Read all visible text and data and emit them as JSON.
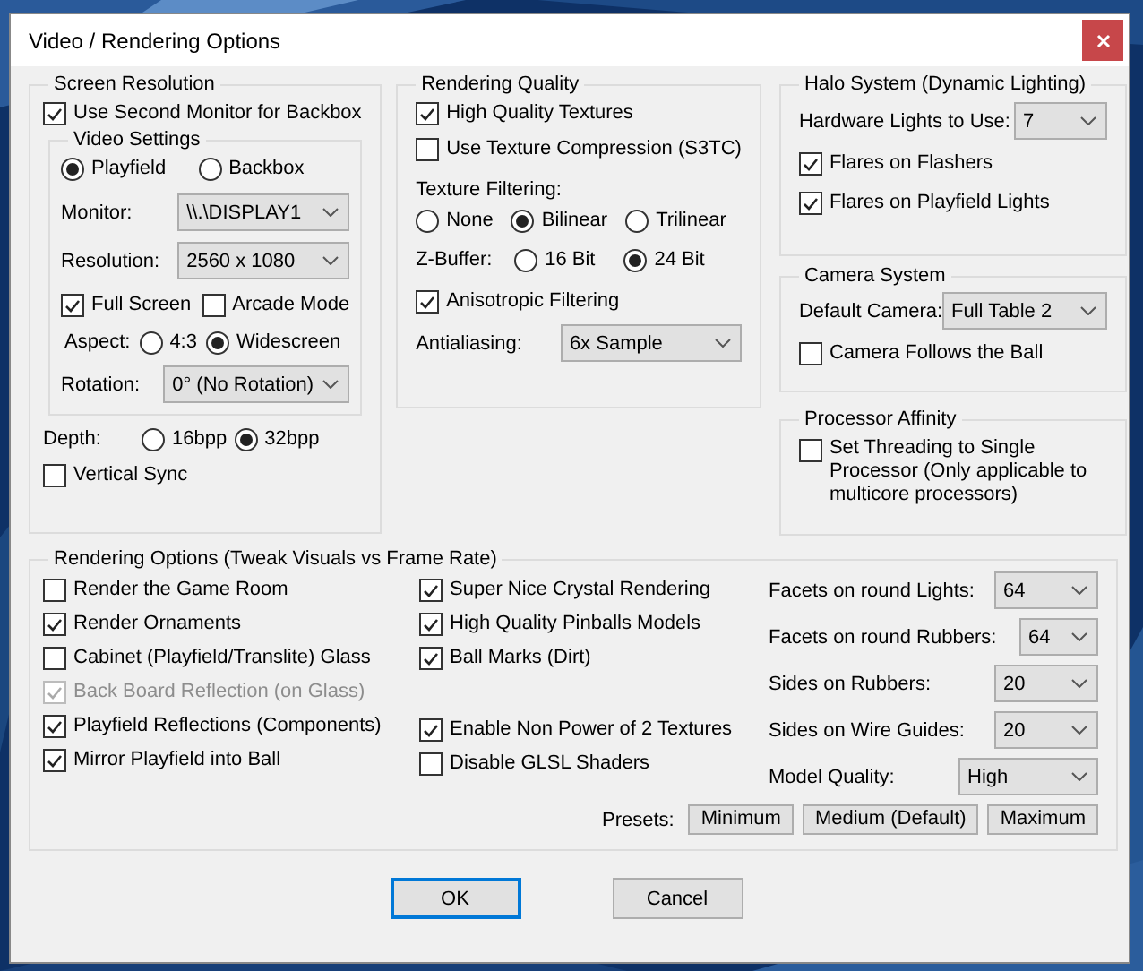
{
  "window": {
    "title": "Video / Rendering Options"
  },
  "screen_resolution": {
    "title": "Screen Resolution",
    "second_monitor": {
      "label": "Use Second Monitor for Backbox",
      "checked": true
    },
    "video_settings": {
      "title": "Video Settings",
      "target": [
        {
          "label": "Playfield",
          "selected": true
        },
        {
          "label": "Backbox",
          "selected": false
        }
      ],
      "monitor": {
        "label": "Monitor:",
        "value": "\\\\.\\DISPLAY1"
      },
      "resolution": {
        "label": "Resolution:",
        "value": "2560 x 1080"
      },
      "full_screen": {
        "label": "Full Screen",
        "checked": true
      },
      "arcade_mode": {
        "label": "Arcade Mode",
        "checked": false
      },
      "aspect": {
        "label": "Aspect:",
        "options": [
          {
            "label": "4:3",
            "selected": false
          },
          {
            "label": "Widescreen",
            "selected": true
          }
        ]
      },
      "rotation": {
        "label": "Rotation:",
        "value": "0° (No Rotation)"
      }
    },
    "depth": {
      "label": "Depth:",
      "options": [
        {
          "label": "16bpp",
          "selected": false
        },
        {
          "label": "32bpp",
          "selected": true
        }
      ]
    },
    "vertical_sync": {
      "label": "Vertical Sync",
      "checked": false
    }
  },
  "rendering_quality": {
    "title": "Rendering Quality",
    "high_quality_textures": {
      "label": "High Quality Textures",
      "checked": true
    },
    "texture_compression": {
      "label": "Use Texture Compression (S3TC)",
      "checked": false
    },
    "texture_filtering": {
      "label": "Texture Filtering:",
      "options": [
        {
          "label": "None",
          "selected": false
        },
        {
          "label": "Bilinear",
          "selected": true
        },
        {
          "label": "Trilinear",
          "selected": false
        }
      ]
    },
    "z_buffer": {
      "label": "Z-Buffer:",
      "options": [
        {
          "label": "16 Bit",
          "selected": false
        },
        {
          "label": "24 Bit",
          "selected": true
        }
      ]
    },
    "anisotropic_filtering": {
      "label": "Anisotropic Filtering",
      "checked": true
    },
    "antialiasing": {
      "label": "Antialiasing:",
      "value": "6x Sample"
    }
  },
  "halo_system": {
    "title": "Halo System (Dynamic Lighting)",
    "hardware_lights": {
      "label": "Hardware Lights to Use:",
      "value": "7"
    },
    "flares_on_flashers": {
      "label": "Flares on Flashers",
      "checked": true
    },
    "flares_on_playfield_lights": {
      "label": "Flares on Playfield Lights",
      "checked": true
    }
  },
  "camera_system": {
    "title": "Camera System",
    "default_camera": {
      "label": "Default Camera:",
      "value": "Full Table 2"
    },
    "follow_ball": {
      "label": "Camera Follows the Ball",
      "checked": false
    }
  },
  "processor_affinity": {
    "title": "Processor Affinity",
    "single_processor": {
      "label": "Set Threading to Single Processor (Only applicable to multicore processors)",
      "checked": false
    }
  },
  "rendering_options": {
    "title": "Rendering Options (Tweak Visuals vs Frame Rate)",
    "column_1": [
      {
        "label": "Render the Game Room",
        "checked": false,
        "disabled": false
      },
      {
        "label": "Render Ornaments",
        "checked": true,
        "disabled": false
      },
      {
        "label": "Cabinet (Playfield/Translite) Glass",
        "checked": false,
        "disabled": false
      },
      {
        "label": "Back Board Reflection (on Glass)",
        "checked": true,
        "disabled": true
      },
      {
        "label": "Playfield Reflections (Components)",
        "checked": true,
        "disabled": false
      },
      {
        "label": "Mirror Playfield into Ball",
        "checked": true,
        "disabled": false
      }
    ],
    "column_2_upper": [
      {
        "label": "Super Nice Crystal Rendering",
        "checked": true
      },
      {
        "label": "High Quality Pinballs Models",
        "checked": true
      },
      {
        "label": "Ball Marks (Dirt)",
        "checked": true
      }
    ],
    "column_2_lower": [
      {
        "label": "Enable Non Power of 2 Textures",
        "checked": true
      },
      {
        "label": "Disable GLSL Shaders",
        "checked": false
      }
    ],
    "selects": [
      {
        "label": "Facets on round Lights:",
        "value": "64"
      },
      {
        "label": "Facets on round Rubbers:",
        "value": "64"
      },
      {
        "label": "Sides on Rubbers:",
        "value": "20"
      },
      {
        "label": "Sides on Wire Guides:",
        "value": "20"
      },
      {
        "label": "Model Quality:",
        "value": "High"
      }
    ],
    "presets": {
      "label": "Presets:",
      "buttons": [
        "Minimum",
        "Medium (Default)",
        "Maximum"
      ]
    }
  },
  "buttons": [
    {
      "label": "OK",
      "default": true
    },
    {
      "label": "Cancel",
      "default": false
    }
  ]
}
